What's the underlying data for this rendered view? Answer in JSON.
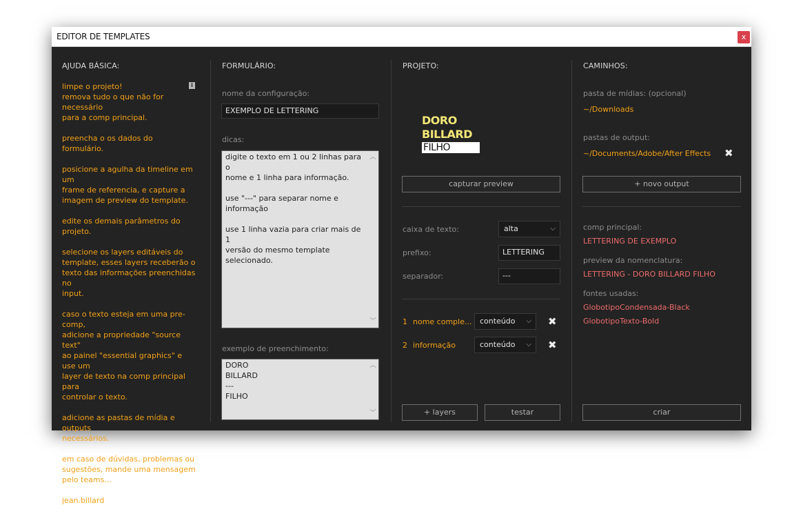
{
  "window": {
    "title": "EDITOR DE TEMPLATES",
    "close_label": "x"
  },
  "help": {
    "header": "AJUDA BÁSICA:",
    "info_icon": "i",
    "paragraphs": [
      [
        "limpe o projeto!",
        "remova tudo o que não for necessário",
        "para a comp principal."
      ],
      [
        "preencha o os dados do formulário."
      ],
      [
        "posicione a agulha da timeline em um",
        "frame de referencia, e capture a",
        "imagem de preview do template."
      ],
      [
        "edite os demais parâmetros do",
        "projeto."
      ],
      [
        "selecione os layers editáveis do",
        "template, esses layers receberão o",
        "texto das informações preenchidas no",
        "input."
      ],
      [
        "caso o texto esteja em uma pre-comp,",
        "adicione a propriedade \"source text\"",
        "ao painel \"essential graphics\" e use um",
        "layer de texto na comp principal para",
        "controlar o texto."
      ],
      [
        "adicione as pastas de mídia e outputs",
        "necessários."
      ],
      [
        "em caso de dúvidas, problemas ou",
        "sugestões, mande uma mensagem",
        "pelo teams..."
      ],
      [
        "jean.billard"
      ]
    ]
  },
  "form": {
    "header": "FORMULÁRIO:",
    "config_label": "nome da configuração:",
    "config_value": "EXEMPLO DE LETTERING",
    "tips_label": "dicas:",
    "tips_paragraphs": [
      [
        "digite o texto em 1 ou 2 linhas para o",
        "nome e 1 linha para informação."
      ],
      [
        "use \"---\" para separar nome e informação"
      ],
      [
        "use 1 linha vazia para criar mais de 1",
        "versão do mesmo template selecionado."
      ]
    ],
    "example_label": "exemplo de preenchimento:",
    "example_lines": [
      "DORO",
      "BILLARD",
      "---",
      "FILHO"
    ]
  },
  "project": {
    "header": "PROJETO:",
    "preview_lines": [
      "DORO",
      "BILLARD",
      "FILHO"
    ],
    "preview_colors": {
      "title": "#f3e777",
      "tag_bg": "#ffffff"
    },
    "capture_button": "capturar preview",
    "textcase_label": "caixa de texto:",
    "textcase_value": "alta",
    "prefix_label": "prefixo:",
    "prefix_value": "LETTERING",
    "separator_label": "separador:",
    "separator_value": "---",
    "layers": [
      {
        "index": "1",
        "name": "nome comple...",
        "type": "conteúdo"
      },
      {
        "index": "2",
        "name": "informação",
        "type": "conteúdo"
      }
    ],
    "add_layers_button": "+ layers",
    "test_button": "testar"
  },
  "paths": {
    "header": "CAMINHOS:",
    "media_label": "pasta de mídias: (opcional)",
    "media_value": "~/Downloads",
    "output_label": "pastas de output:",
    "output_value": "~/Documents/Adobe/After Effects",
    "new_output_button": "+ novo output",
    "comp_label": "comp principal:",
    "comp_value": "LETTERING DE EXEMPLO",
    "naming_label": "preview da nomenclatura:",
    "naming_value": "LETTERING - DORO BILLARD FILHO",
    "fonts_label": "fontes usadas:",
    "fonts": [
      "GlobotipoCondensada-Black",
      "GlobotipoTexto-Bold"
    ],
    "create_button": "criar"
  },
  "colors": {
    "background": "#232323",
    "help_text": "#f2a118",
    "highlight_text": "#ef6b6b",
    "close_button": "#d9414c"
  },
  "icons": {
    "close": "close-icon",
    "info": "info-icon",
    "remove": "x-icon",
    "dropdown": "chevron-down-icon",
    "scroll_up": "chevron-up-icon",
    "scroll_down": "chevron-down-icon"
  }
}
